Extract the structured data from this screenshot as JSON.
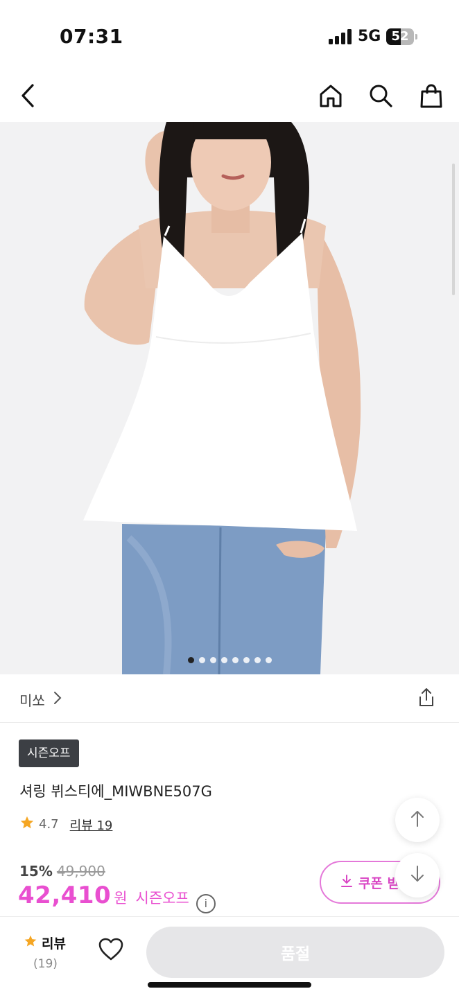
{
  "status": {
    "time": "07:31",
    "network": "5G",
    "battery": "52",
    "battery_level": 0.52
  },
  "header": {
    "icons": [
      "back-icon",
      "home-icon",
      "search-icon",
      "shopping-bag-icon"
    ]
  },
  "gallery": {
    "image_count": 8,
    "active_index": 0
  },
  "brand": {
    "name": "미쏘"
  },
  "product": {
    "badge": "시즌오프",
    "title": "셔링 뷔스티에_MIWBNE507G",
    "rating": "4.7",
    "review_link": "리뷰 19",
    "discount": "15%",
    "original_price": "49,900",
    "sale_price": "42,410",
    "currency": "원",
    "season_label": "시즌오프",
    "info_icon": "i"
  },
  "coupon": {
    "label": "쿠폰 받"
  },
  "bottom": {
    "review_label": "리뷰",
    "review_count": "(19)",
    "soldout_label": "품절"
  },
  "colors": {
    "accent": "#e94fd0",
    "star": "#f5a623",
    "badge_bg": "#3c3f44"
  }
}
